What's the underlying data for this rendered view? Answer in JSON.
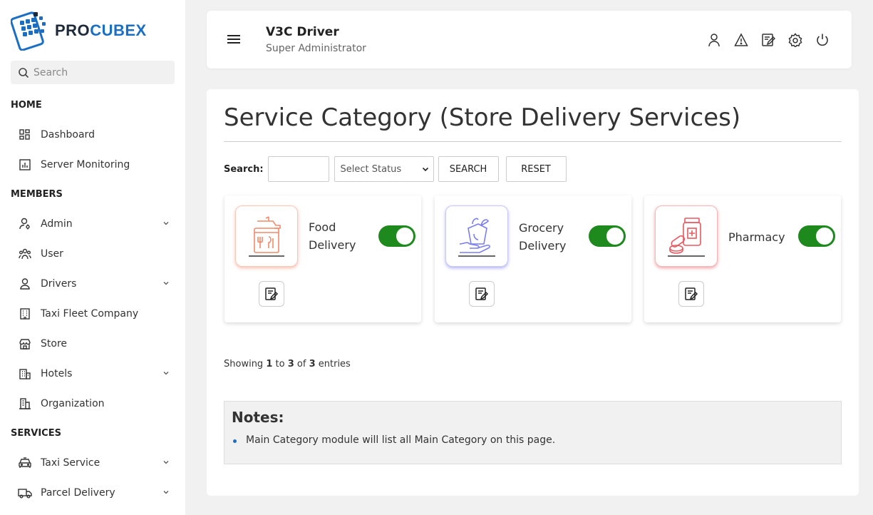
{
  "brand": {
    "name_part1": "PRO",
    "name_part2": "CUBEX"
  },
  "sidebar": {
    "search_placeholder": "Search",
    "sections": [
      {
        "title": "HOME",
        "items": [
          {
            "label": "Dashboard",
            "icon": "dashboard-icon"
          },
          {
            "label": "Server Monitoring",
            "icon": "chart-icon"
          }
        ]
      },
      {
        "title": "MEMBERS",
        "items": [
          {
            "label": "Admin",
            "icon": "admin-icon",
            "expandable": true
          },
          {
            "label": "User",
            "icon": "users-icon"
          },
          {
            "label": "Drivers",
            "icon": "driver-icon",
            "expandable": true
          },
          {
            "label": "Taxi Fleet Company",
            "icon": "building-icon"
          },
          {
            "label": "Store",
            "icon": "store-icon"
          },
          {
            "label": "Hotels",
            "icon": "hotel-icon",
            "expandable": true
          },
          {
            "label": "Organization",
            "icon": "organization-icon"
          }
        ]
      },
      {
        "title": "SERVICES",
        "items": [
          {
            "label": "Taxi Service",
            "icon": "taxi-icon",
            "expandable": true
          },
          {
            "label": "Parcel Delivery",
            "icon": "truck-icon",
            "expandable": true
          }
        ]
      }
    ]
  },
  "header": {
    "user_name": "V3C Driver",
    "user_role": "Super Administrator"
  },
  "page": {
    "title": "Service Category (Store Delivery Services)",
    "filters": {
      "search_label": "Search:",
      "search_value": "",
      "status_selected": "Select Status",
      "search_button": "SEARCH",
      "reset_button": "RESET"
    },
    "cards": [
      {
        "name": "Food Delivery",
        "enabled": true,
        "accent": "#f08a6a"
      },
      {
        "name": "Grocery Delivery",
        "enabled": true,
        "accent": "#7a7ef0"
      },
      {
        "name": "Pharmacy",
        "enabled": true,
        "accent": "#e8585e"
      }
    ],
    "showing": {
      "prefix": "Showing",
      "from": "1",
      "to_word": "to",
      "to": "3",
      "of_word": "of",
      "total": "3",
      "suffix": "entries"
    },
    "notes": {
      "title": "Notes:",
      "items": [
        "Main Category module will list all Main Category on this page."
      ]
    }
  },
  "colors": {
    "brand_blue": "#1a6fc4",
    "toggle_on": "#1e8a1e"
  }
}
